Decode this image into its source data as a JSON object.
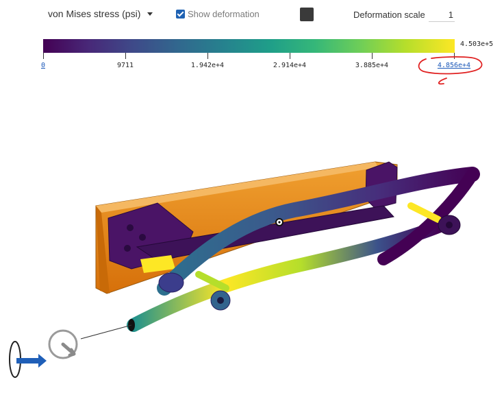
{
  "toolbar": {
    "result_type": "von Mises stress (psi)",
    "show_deformation_label": "Show deformation",
    "show_deformation_checked": true,
    "deformation_scale_label": "Deformation scale",
    "deformation_scale_value": "1"
  },
  "legend": {
    "max_value_label": "4.503e+5",
    "ticks": [
      "0",
      "9711",
      "1.942e+4",
      "2.914e+4",
      "3.885e+4",
      "4.856e+4"
    ],
    "colormap": "viridis",
    "annotation_color": "#e02020"
  },
  "colors": {
    "link": "#1a57b8",
    "checkbox": "#1f62b3",
    "orange_part": "#e07f10",
    "low_stress": "#440154",
    "high_stress": "#fde725",
    "arrow_blue": "#1f5fb8"
  }
}
